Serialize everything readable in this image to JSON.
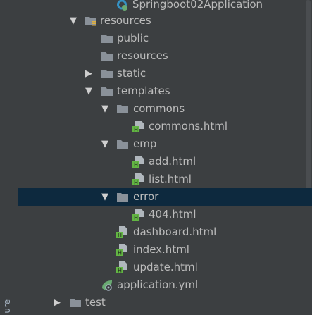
{
  "side_panel": {
    "label": "ure"
  },
  "tree": {
    "springboot_app": "Springboot02Application",
    "resources_root": "resources",
    "public": "public",
    "resources_sub": "resources",
    "static": "static",
    "templates": "templates",
    "commons_folder": "commons",
    "commons_html": "commons.html",
    "emp": "emp",
    "add_html": "add.html",
    "list_html": "list.html",
    "error": "error",
    "e404_html": "404.html",
    "dashboard_html": "dashboard.html",
    "index_html": "index.html",
    "update_html": "update.html",
    "application_yml": "application.yml",
    "test": "test"
  },
  "icons": {
    "expanded": "chevron-down-icon",
    "collapsed": "chevron-right-icon",
    "folder": "folder-icon",
    "resources_folder": "resources-root-folder-icon",
    "html_file": "html-file-icon",
    "spring_class": "spring-boot-class-icon",
    "yml_file": "spring-yml-icon"
  },
  "colors": {
    "background": "#3c3f41",
    "selection": "#0d293e",
    "text": "#bbbbbb",
    "folder": "#8a9199",
    "html_green": "#62b543"
  }
}
